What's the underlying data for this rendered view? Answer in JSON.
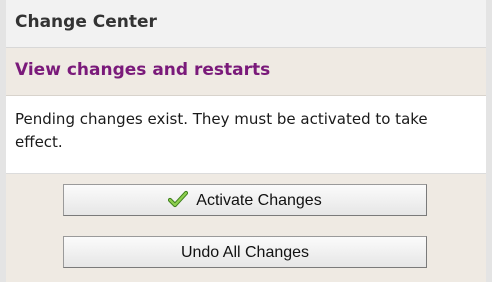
{
  "panel": {
    "title": "Change Center",
    "subtitle": "View changes and restarts",
    "message": "Pending changes exist. They must be activated to take effect.",
    "buttons": {
      "activate_label": "Activate Changes",
      "undo_label": "Undo All Changes"
    },
    "icons": {
      "activate": "check-icon"
    },
    "colors": {
      "subtitle": "#7a1a7a",
      "check": "#5aa02c",
      "band_background": "#efeae3"
    }
  }
}
